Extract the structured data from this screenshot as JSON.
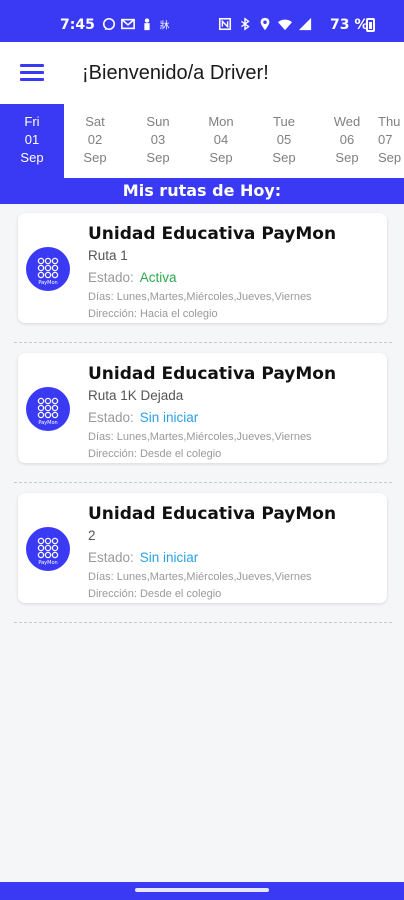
{
  "status_bar": {
    "time": "7:45",
    "battery_text": "73 %",
    "left_icons": [
      "whatsapp-icon",
      "gmail-icon",
      "person-icon",
      "translate-icon"
    ],
    "right_icons": [
      "nfc-icon",
      "bluetooth-icon",
      "location-icon",
      "wifi-icon",
      "signal-icon"
    ]
  },
  "app_bar": {
    "title": "¡Bienvenido/a Driver!",
    "menu_icon": "hamburger-menu-icon"
  },
  "dates": [
    {
      "day": "Fri",
      "num": "01",
      "month": "Sep",
      "active": true
    },
    {
      "day": "Sat",
      "num": "02",
      "month": "Sep"
    },
    {
      "day": "Sun",
      "num": "03",
      "month": "Sep"
    },
    {
      "day": "Mon",
      "num": "04",
      "month": "Sep"
    },
    {
      "day": "Tue",
      "num": "05",
      "month": "Sep"
    },
    {
      "day": "Wed",
      "num": "06",
      "month": "Sep"
    },
    {
      "day": "Thu",
      "num": "07",
      "month": "Sep"
    }
  ],
  "section_title": "Mis rutas de Hoy:",
  "routes": [
    {
      "school": "Unidad Educativa PayMon",
      "route": "Ruta 1",
      "state_label": "Estado:",
      "state_value": "Activa",
      "days": "Días: Lunes,Martes,Miércoles,Jueves,Viernes",
      "direction": "Dirección: Hacia el colegio"
    },
    {
      "school": "Unidad Educativa PayMon",
      "route": "Ruta 1K Dejada",
      "state_label": "Estado:",
      "state_value": "Sin iniciar",
      "days": "Días: Lunes,Martes,Miércoles,Jueves,Viernes",
      "direction": "Dirección: Desde el colegio"
    },
    {
      "school": "Unidad Educativa PayMon",
      "route": "2",
      "state_label": "Estado:",
      "state_value": "Sin iniciar",
      "days": "Días: Lunes,Martes,Miércoles,Jueves,Viernes",
      "direction": "Dirección: Desde el colegio"
    }
  ],
  "logo_text": "PayMon",
  "colors": {
    "primary": "#3a3af5",
    "active_state": "#2fa84f",
    "pending_state": "#2aa0e6"
  }
}
